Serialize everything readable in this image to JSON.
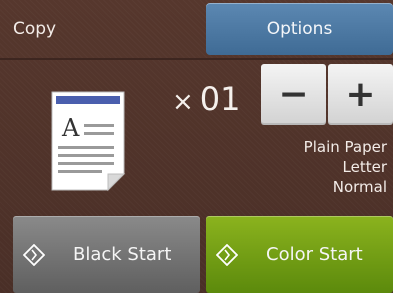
{
  "header": {
    "title": "Copy",
    "options_label": "Options"
  },
  "copies": {
    "multiplier": "×",
    "count": "01",
    "minus_label": "−",
    "plus_label": "+"
  },
  "settings": {
    "paper_type": "Plain Paper",
    "paper_size": "Letter",
    "quality": "Normal"
  },
  "actions": {
    "black_start_label": "Black Start",
    "color_start_label": "Color Start"
  },
  "icons": {
    "document": "document-icon",
    "start": "diamond-start-icon"
  },
  "colors": {
    "background": "#4a2f27",
    "options_button": "#4a7aa6",
    "black_start": "#6f6f6f",
    "color_start": "#6f9a12",
    "doc_header_bar": "#4a5fae"
  }
}
